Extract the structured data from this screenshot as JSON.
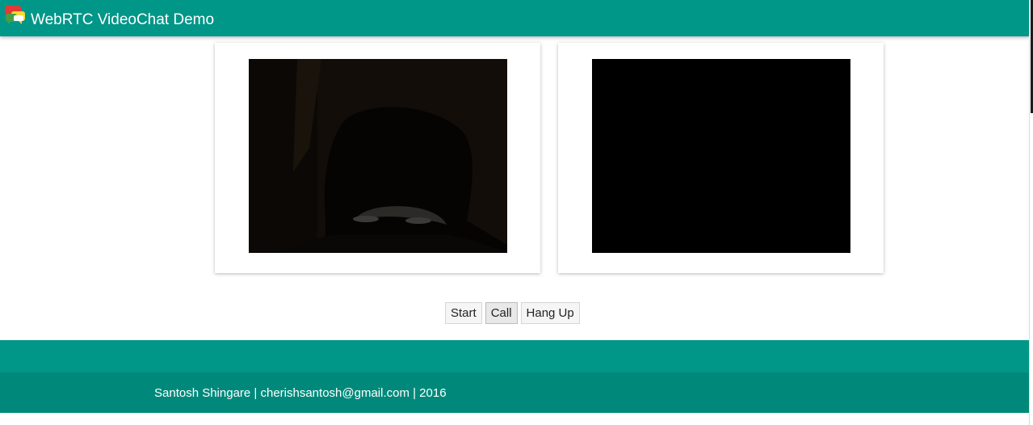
{
  "app": {
    "title": "WebRTC VideoChat Demo",
    "accent_color": "#009688",
    "footer_dark_color": "#00897b",
    "logo_icon": "chat-bubbles-logo-icon"
  },
  "videos": {
    "local": {
      "label": "local-video",
      "state": "streaming"
    },
    "remote": {
      "label": "remote-video",
      "state": "blank"
    }
  },
  "controls": {
    "start_label": "Start",
    "call_label": "Call",
    "hangup_label": "Hang Up"
  },
  "footer": {
    "credit": "Santosh Shingare | cherishsantosh@gmail.com | 2016"
  }
}
